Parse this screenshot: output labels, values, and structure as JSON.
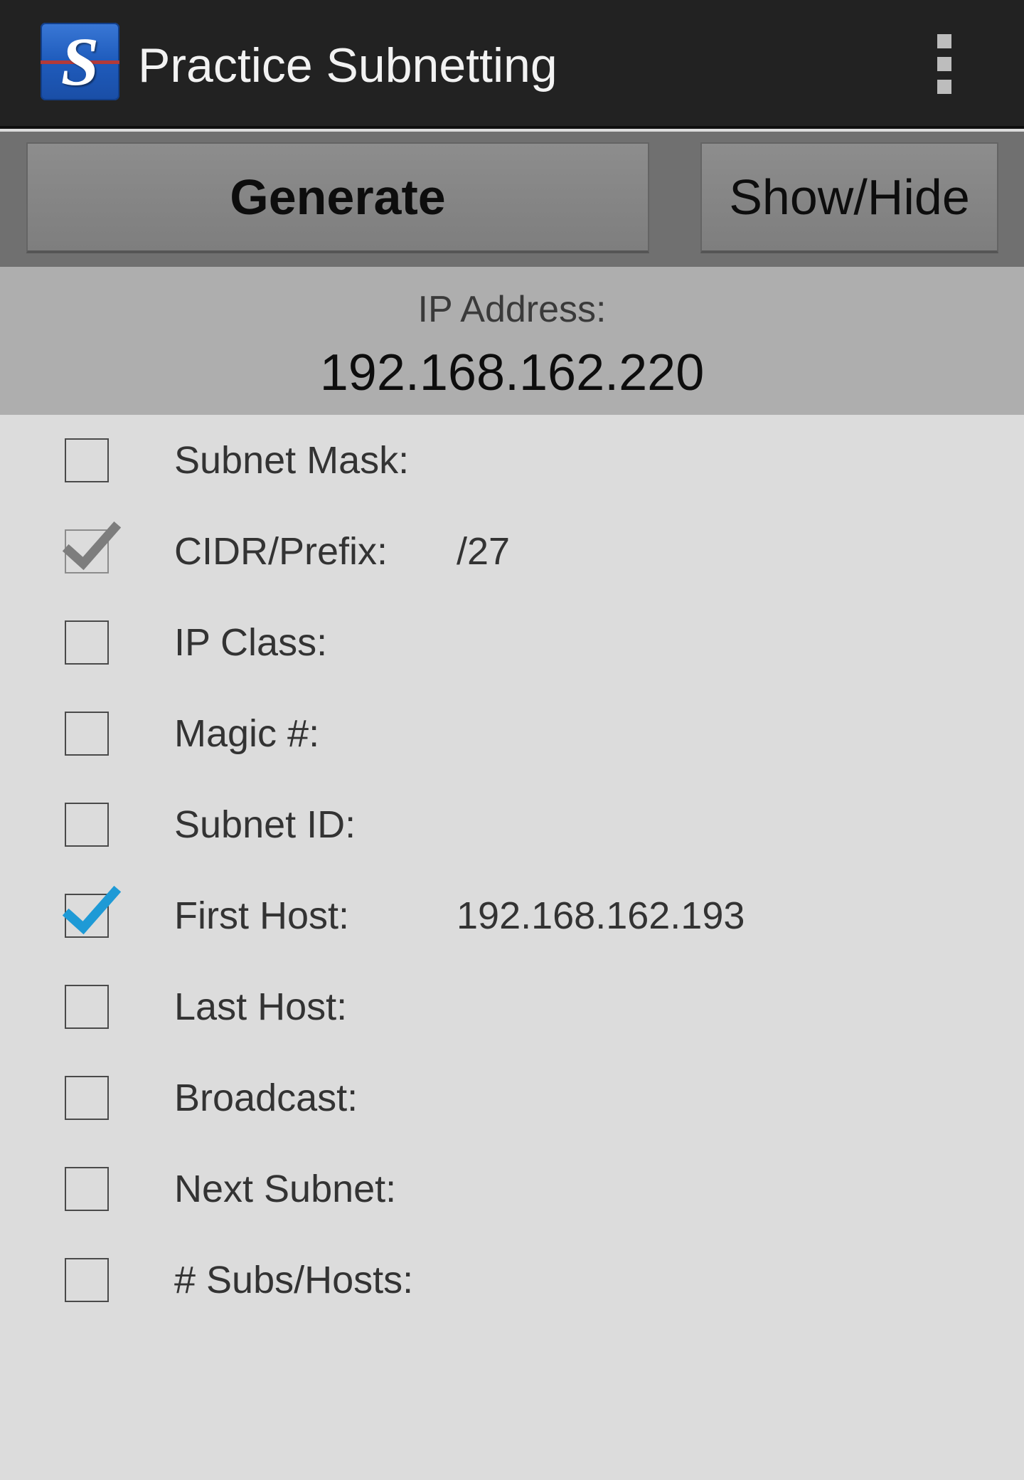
{
  "app": {
    "title": "Practice Subnetting",
    "logo_letter": "S"
  },
  "toolbar": {
    "generate_label": "Generate",
    "showhide_label": "Show/Hide"
  },
  "ip": {
    "label": "IP Address:",
    "value": "192.168.162.220"
  },
  "fields": [
    {
      "label": "Subnet Mask:",
      "checked": false,
      "value": ""
    },
    {
      "label": "CIDR/Prefix:",
      "checked": true,
      "check_style": "gray",
      "value": "/27"
    },
    {
      "label": "IP Class:",
      "checked": false,
      "value": ""
    },
    {
      "label": "Magic #:",
      "checked": false,
      "value": ""
    },
    {
      "label": "Subnet ID:",
      "checked": false,
      "value": ""
    },
    {
      "label": "First Host:",
      "checked": true,
      "check_style": "blue",
      "value": "192.168.162.193"
    },
    {
      "label": "Last Host:",
      "checked": false,
      "value": ""
    },
    {
      "label": "Broadcast:",
      "checked": false,
      "value": ""
    },
    {
      "label": "Next Subnet:",
      "checked": false,
      "value": ""
    },
    {
      "label": "# Subs/Hosts:",
      "checked": false,
      "value": ""
    }
  ],
  "colors": {
    "appbar": "#222222",
    "toolbar": "#707070",
    "ip_panel": "#aeaeae",
    "content": "#dcdcdc",
    "check_blue": "#1e9ad6",
    "check_gray": "#7d7d7d"
  },
  "icons": {
    "menu": "overflow-menu-icon",
    "check": "checkmark-icon"
  }
}
